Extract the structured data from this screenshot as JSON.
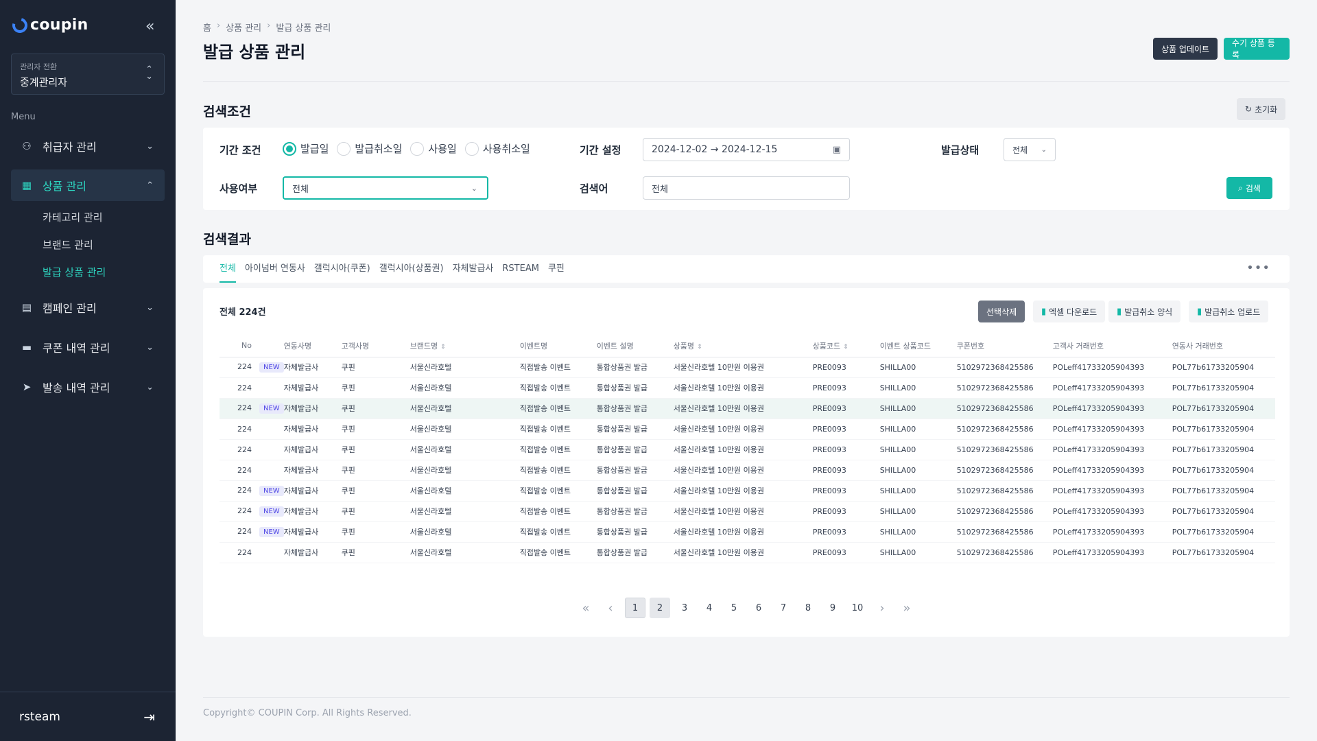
{
  "brand": {
    "name": "coupin"
  },
  "sidebar": {
    "admin_switch_label": "관리자 전환",
    "admin_switch_value": "중계관리자",
    "menu_title": "Menu",
    "items": [
      {
        "label": "취급자 관리"
      },
      {
        "label": "상품 관리"
      },
      {
        "label": "캠페인 관리"
      },
      {
        "label": "쿠폰 내역 관리"
      },
      {
        "label": "발송 내역 관리"
      }
    ],
    "sub_items": [
      {
        "label": "카테고리 관리"
      },
      {
        "label": "브랜드 관리"
      },
      {
        "label": "발급 상품 관리"
      }
    ],
    "user": "rsteam"
  },
  "breadcrumb": [
    "홈",
    "상품 관리",
    "발급 상품 관리"
  ],
  "page_title": "발급 상품 관리",
  "header_buttons": {
    "update": "상품 업데이트",
    "manual": "수기 상품 등록"
  },
  "search": {
    "title": "검색조건",
    "reset": "초기화",
    "period_label": "기간 조건",
    "radios": [
      "발급일",
      "발급취소일",
      "사용일",
      "사용취소일"
    ],
    "radio_selected": "발급일",
    "date_label": "기간 설정",
    "date_value": "2024-12-02 → 2024-12-15",
    "status_label": "발급상태",
    "status_value": "전체",
    "use_label": "사용여부",
    "use_value": "전체",
    "keyword_label": "검색어",
    "keyword_placeholder": "전체",
    "search_button": "검색"
  },
  "results": {
    "title": "검색결과",
    "tabs": [
      "전체",
      "아이넘버 연동사",
      "갤럭시아(쿠폰)",
      "갤럭시아(상품권)",
      "자체발급사",
      "RSTEAM",
      "쿠핀"
    ],
    "active_tab": "전체",
    "total": "전체 224건",
    "actions": {
      "delete": "선택삭제",
      "excel": "엑셀 다운로드",
      "cancel_form": "발급취소 양식",
      "cancel_upload": "발급취소 업로드"
    },
    "columns": [
      "No",
      "연동사명",
      "고객사명",
      "브랜드명",
      "이벤트명",
      "이벤트 설명",
      "상품명",
      "상품코드",
      "이벤트 상품코드",
      "쿠폰번호",
      "고객사 거래번호",
      "연동사 거래번호"
    ],
    "new_badge": "NEW",
    "rows": [
      {
        "no": "224",
        "new": true,
        "partner": "자체발급사",
        "client": "쿠핀",
        "brand": "서울신라호텔",
        "event": "직접발송 이벤트",
        "event_desc": "통합상품권 발급",
        "product": "서울신라호텔 10만원 이용권",
        "code": "PRE0093",
        "event_code": "SHILLA00",
        "coupon": "5102972368425586",
        "client_tx": "POLeff41733205904393",
        "partner_tx": "POL77b61733205904"
      },
      {
        "no": "224",
        "new": false,
        "partner": "자체발급사",
        "client": "쿠핀",
        "brand": "서울신라호텔",
        "event": "직접발송 이벤트",
        "event_desc": "통합상품권 발급",
        "product": "서울신라호텔 10만원 이용권",
        "code": "PRE0093",
        "event_code": "SHILLA00",
        "coupon": "5102972368425586",
        "client_tx": "POLeff41733205904393",
        "partner_tx": "POL77b61733205904"
      },
      {
        "no": "224",
        "new": true,
        "partner": "자체발급사",
        "client": "쿠핀",
        "brand": "서울신라호텔",
        "event": "직접발송 이벤트",
        "event_desc": "통합상품권 발급",
        "product": "서울신라호텔 10만원 이용권",
        "code": "PRE0093",
        "event_code": "SHILLA00",
        "coupon": "5102972368425586",
        "client_tx": "POLeff41733205904393",
        "partner_tx": "POL77b61733205904"
      },
      {
        "no": "224",
        "new": false,
        "partner": "자체발급사",
        "client": "쿠핀",
        "brand": "서울신라호텔",
        "event": "직접발송 이벤트",
        "event_desc": "통합상품권 발급",
        "product": "서울신라호텔 10만원 이용권",
        "code": "PRE0093",
        "event_code": "SHILLA00",
        "coupon": "5102972368425586",
        "client_tx": "POLeff41733205904393",
        "partner_tx": "POL77b61733205904"
      },
      {
        "no": "224",
        "new": false,
        "partner": "자체발급사",
        "client": "쿠핀",
        "brand": "서울신라호텔",
        "event": "직접발송 이벤트",
        "event_desc": "통합상품권 발급",
        "product": "서울신라호텔 10만원 이용권",
        "code": "PRE0093",
        "event_code": "SHILLA00",
        "coupon": "5102972368425586",
        "client_tx": "POLeff41733205904393",
        "partner_tx": "POL77b61733205904"
      },
      {
        "no": "224",
        "new": false,
        "partner": "자체발급사",
        "client": "쿠핀",
        "brand": "서울신라호텔",
        "event": "직접발송 이벤트",
        "event_desc": "통합상품권 발급",
        "product": "서울신라호텔 10만원 이용권",
        "code": "PRE0093",
        "event_code": "SHILLA00",
        "coupon": "5102972368425586",
        "client_tx": "POLeff41733205904393",
        "partner_tx": "POL77b61733205904"
      },
      {
        "no": "224",
        "new": true,
        "partner": "자체발급사",
        "client": "쿠핀",
        "brand": "서울신라호텔",
        "event": "직접발송 이벤트",
        "event_desc": "통합상품권 발급",
        "product": "서울신라호텔 10만원 이용권",
        "code": "PRE0093",
        "event_code": "SHILLA00",
        "coupon": "5102972368425586",
        "client_tx": "POLeff41733205904393",
        "partner_tx": "POL77b61733205904"
      },
      {
        "no": "224",
        "new": true,
        "partner": "자체발급사",
        "client": "쿠핀",
        "brand": "서울신라호텔",
        "event": "직접발송 이벤트",
        "event_desc": "통합상품권 발급",
        "product": "서울신라호텔 10만원 이용권",
        "code": "PRE0093",
        "event_code": "SHILLA00",
        "coupon": "5102972368425586",
        "client_tx": "POLeff41733205904393",
        "partner_tx": "POL77b61733205904"
      },
      {
        "no": "224",
        "new": true,
        "partner": "자체발급사",
        "client": "쿠핀",
        "brand": "서울신라호텔",
        "event": "직접발송 이벤트",
        "event_desc": "통합상품권 발급",
        "product": "서울신라호텔 10만원 이용권",
        "code": "PRE0093",
        "event_code": "SHILLA00",
        "coupon": "5102972368425586",
        "client_tx": "POLeff41733205904393",
        "partner_tx": "POL77b61733205904"
      },
      {
        "no": "224",
        "new": false,
        "partner": "자체발급사",
        "client": "쿠핀",
        "brand": "서울신라호텔",
        "event": "직접발송 이벤트",
        "event_desc": "통합상품권 발급",
        "product": "서울신라호텔 10만원 이용권",
        "code": "PRE0093",
        "event_code": "SHILLA00",
        "coupon": "5102972368425586",
        "client_tx": "POLeff41733205904393",
        "partner_tx": "POL77b61733205904"
      }
    ],
    "highlighted_row": 3
  },
  "pagination": {
    "pages": [
      "1",
      "2",
      "3",
      "4",
      "5",
      "6",
      "7",
      "8",
      "9",
      "10"
    ],
    "current": "1"
  },
  "footer": {
    "copyright": "Copyright© COUPIN Corp. All Rights Reserved."
  },
  "colors": {
    "sidebar_bg": "#1c2433",
    "accent": "#14b8a6",
    "dark_button": "#2d3748"
  }
}
